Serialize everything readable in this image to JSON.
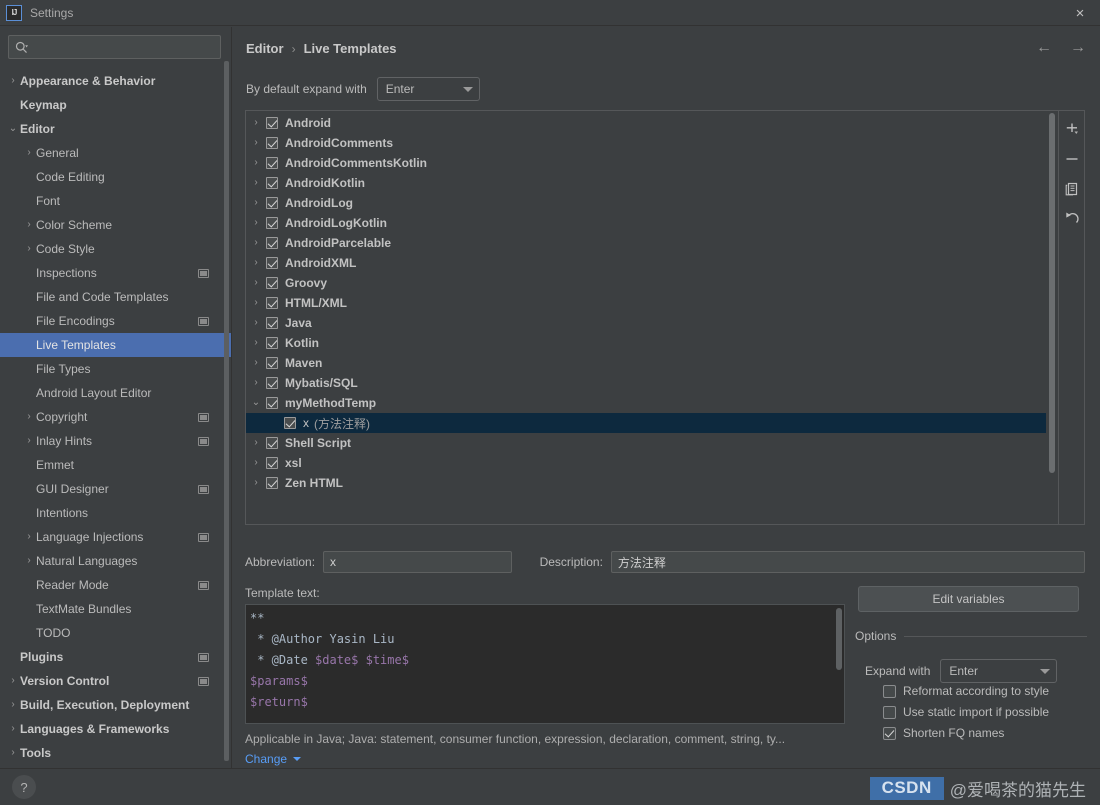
{
  "window": {
    "title": "Settings",
    "logo_text": "IJ",
    "close_icon": "×"
  },
  "sidebar": {
    "search": {
      "value": "",
      "placeholder": ""
    },
    "items": [
      {
        "label": "Appearance & Behavior",
        "level": 0,
        "arrow": "collapsed",
        "bold": true,
        "badge": false,
        "selected": false
      },
      {
        "label": "Keymap",
        "level": 0,
        "arrow": "none",
        "bold": true,
        "badge": false,
        "selected": false
      },
      {
        "label": "Editor",
        "level": 0,
        "arrow": "expanded",
        "bold": true,
        "badge": false,
        "selected": false
      },
      {
        "label": "General",
        "level": 1,
        "arrow": "collapsed",
        "bold": false,
        "badge": false,
        "selected": false
      },
      {
        "label": "Code Editing",
        "level": 1,
        "arrow": "none",
        "bold": false,
        "badge": false,
        "selected": false
      },
      {
        "label": "Font",
        "level": 1,
        "arrow": "none",
        "bold": false,
        "badge": false,
        "selected": false
      },
      {
        "label": "Color Scheme",
        "level": 1,
        "arrow": "collapsed",
        "bold": false,
        "badge": false,
        "selected": false
      },
      {
        "label": "Code Style",
        "level": 1,
        "arrow": "collapsed",
        "bold": false,
        "badge": false,
        "selected": false
      },
      {
        "label": "Inspections",
        "level": 1,
        "arrow": "none",
        "bold": false,
        "badge": true,
        "selected": false
      },
      {
        "label": "File and Code Templates",
        "level": 1,
        "arrow": "none",
        "bold": false,
        "badge": false,
        "selected": false
      },
      {
        "label": "File Encodings",
        "level": 1,
        "arrow": "none",
        "bold": false,
        "badge": true,
        "selected": false
      },
      {
        "label": "Live Templates",
        "level": 1,
        "arrow": "none",
        "bold": false,
        "badge": false,
        "selected": true
      },
      {
        "label": "File Types",
        "level": 1,
        "arrow": "none",
        "bold": false,
        "badge": false,
        "selected": false
      },
      {
        "label": "Android Layout Editor",
        "level": 1,
        "arrow": "none",
        "bold": false,
        "badge": false,
        "selected": false
      },
      {
        "label": "Copyright",
        "level": 1,
        "arrow": "collapsed",
        "bold": false,
        "badge": true,
        "selected": false
      },
      {
        "label": "Inlay Hints",
        "level": 1,
        "arrow": "collapsed",
        "bold": false,
        "badge": true,
        "selected": false
      },
      {
        "label": "Emmet",
        "level": 1,
        "arrow": "none",
        "bold": false,
        "badge": false,
        "selected": false
      },
      {
        "label": "GUI Designer",
        "level": 1,
        "arrow": "none",
        "bold": false,
        "badge": true,
        "selected": false
      },
      {
        "label": "Intentions",
        "level": 1,
        "arrow": "none",
        "bold": false,
        "badge": false,
        "selected": false
      },
      {
        "label": "Language Injections",
        "level": 1,
        "arrow": "collapsed",
        "bold": false,
        "badge": true,
        "selected": false
      },
      {
        "label": "Natural Languages",
        "level": 1,
        "arrow": "collapsed",
        "bold": false,
        "badge": false,
        "selected": false
      },
      {
        "label": "Reader Mode",
        "level": 1,
        "arrow": "none",
        "bold": false,
        "badge": true,
        "selected": false
      },
      {
        "label": "TextMate Bundles",
        "level": 1,
        "arrow": "none",
        "bold": false,
        "badge": false,
        "selected": false
      },
      {
        "label": "TODO",
        "level": 1,
        "arrow": "none",
        "bold": false,
        "badge": false,
        "selected": false
      },
      {
        "label": "Plugins",
        "level": 0,
        "arrow": "none",
        "bold": true,
        "badge": true,
        "selected": false
      },
      {
        "label": "Version Control",
        "level": 0,
        "arrow": "collapsed",
        "bold": true,
        "badge": true,
        "selected": false
      },
      {
        "label": "Build, Execution, Deployment",
        "level": 0,
        "arrow": "collapsed",
        "bold": true,
        "badge": false,
        "selected": false
      },
      {
        "label": "Languages & Frameworks",
        "level": 0,
        "arrow": "collapsed",
        "bold": true,
        "badge": false,
        "selected": false
      },
      {
        "label": "Tools",
        "level": 0,
        "arrow": "collapsed",
        "bold": true,
        "badge": false,
        "selected": false
      }
    ]
  },
  "main": {
    "breadcrumb": {
      "parent": "Editor",
      "separator": "›",
      "current": "Live Templates"
    },
    "nav": {
      "back_icon": "←",
      "forward_icon": "→"
    },
    "expand_with": {
      "label": "By default expand with",
      "value": "Enter"
    },
    "templates": [
      {
        "label": "Android",
        "level": 0,
        "arrow": "collapsed",
        "checked": true,
        "selected": false,
        "desc": ""
      },
      {
        "label": "AndroidComments",
        "level": 0,
        "arrow": "collapsed",
        "checked": true,
        "selected": false,
        "desc": ""
      },
      {
        "label": "AndroidCommentsKotlin",
        "level": 0,
        "arrow": "collapsed",
        "checked": true,
        "selected": false,
        "desc": ""
      },
      {
        "label": "AndroidKotlin",
        "level": 0,
        "arrow": "collapsed",
        "checked": true,
        "selected": false,
        "desc": ""
      },
      {
        "label": "AndroidLog",
        "level": 0,
        "arrow": "collapsed",
        "checked": true,
        "selected": false,
        "desc": ""
      },
      {
        "label": "AndroidLogKotlin",
        "level": 0,
        "arrow": "collapsed",
        "checked": true,
        "selected": false,
        "desc": ""
      },
      {
        "label": "AndroidParcelable",
        "level": 0,
        "arrow": "collapsed",
        "checked": true,
        "selected": false,
        "desc": ""
      },
      {
        "label": "AndroidXML",
        "level": 0,
        "arrow": "collapsed",
        "checked": true,
        "selected": false,
        "desc": ""
      },
      {
        "label": "Groovy",
        "level": 0,
        "arrow": "collapsed",
        "checked": true,
        "selected": false,
        "desc": ""
      },
      {
        "label": "HTML/XML",
        "level": 0,
        "arrow": "collapsed",
        "checked": true,
        "selected": false,
        "desc": ""
      },
      {
        "label": "Java",
        "level": 0,
        "arrow": "collapsed",
        "checked": true,
        "selected": false,
        "desc": ""
      },
      {
        "label": "Kotlin",
        "level": 0,
        "arrow": "collapsed",
        "checked": true,
        "selected": false,
        "desc": ""
      },
      {
        "label": "Maven",
        "level": 0,
        "arrow": "collapsed",
        "checked": true,
        "selected": false,
        "desc": ""
      },
      {
        "label": "Mybatis/SQL",
        "level": 0,
        "arrow": "collapsed",
        "checked": true,
        "selected": false,
        "desc": ""
      },
      {
        "label": "myMethodTemp",
        "level": 0,
        "arrow": "expanded",
        "checked": true,
        "selected": false,
        "desc": ""
      },
      {
        "label": "x",
        "level": 1,
        "arrow": "none",
        "checked": true,
        "selected": true,
        "desc": "(方法注释)"
      },
      {
        "label": "Shell Script",
        "level": 0,
        "arrow": "collapsed",
        "checked": true,
        "selected": false,
        "desc": ""
      },
      {
        "label": "xsl",
        "level": 0,
        "arrow": "collapsed",
        "checked": true,
        "selected": false,
        "desc": ""
      },
      {
        "label": "Zen HTML",
        "level": 0,
        "arrow": "collapsed",
        "checked": true,
        "selected": false,
        "desc": ""
      }
    ],
    "toolbar": {
      "add_label": "add-template",
      "remove_label": "remove-template",
      "duplicate_label": "duplicate-template",
      "revert_label": "restore-defaults"
    },
    "abbreviation": {
      "label": "Abbreviation:",
      "value": "x"
    },
    "description": {
      "label": "Description:",
      "value": "方法注释"
    },
    "template_text": {
      "label": "Template text:",
      "lines": [
        {
          "parts": [
            {
              "t": "**",
              "var": false
            }
          ]
        },
        {
          "parts": [
            {
              "t": " * @Author Yasin Liu",
              "var": false
            }
          ]
        },
        {
          "parts": [
            {
              "t": " * @Date ",
              "var": false
            },
            {
              "t": "$date$ $time$",
              "var": true
            }
          ]
        },
        {
          "parts": [
            {
              "t": "$params$",
              "var": true
            }
          ]
        },
        {
          "parts": [
            {
              "t": "$return$",
              "var": true
            }
          ]
        }
      ]
    },
    "applicable": "Applicable in Java; Java: statement, consumer function, expression, declaration, comment, string, ty...",
    "change_link": "Change"
  },
  "options": {
    "edit_variables_label": "Edit variables",
    "title": "Options",
    "expand_with": {
      "label": "Expand with",
      "value": "Enter"
    },
    "checkboxes": [
      {
        "label": "Reformat according to style",
        "checked": false
      },
      {
        "label": "Use static import if possible",
        "checked": false
      },
      {
        "label": "Shorten FQ names",
        "checked": true
      }
    ]
  },
  "footer": {
    "help_icon": "?",
    "watermark_brand": "CSDN",
    "watermark_user": "@爱喝茶的猫先生"
  },
  "colors": {
    "accent_selection": "#4b6eaf",
    "tree_selection": "#0d293e",
    "link": "#589df6",
    "template_var": "#9876aa",
    "watermark_badge": "#3f6fa8"
  }
}
